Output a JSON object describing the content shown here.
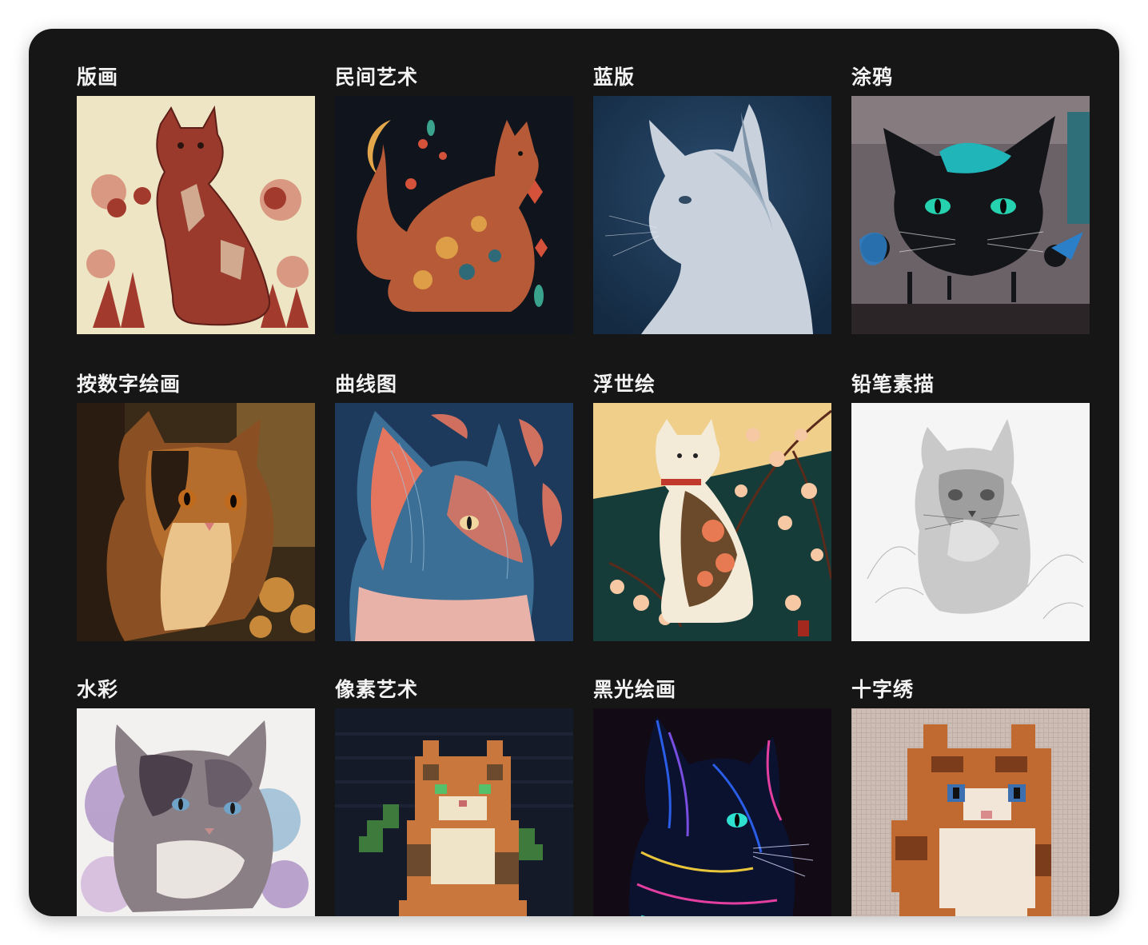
{
  "styles": [
    {
      "id": "print",
      "label": "版画",
      "colors": {
        "bg": "#ede5c4",
        "fg": "#a33a2e",
        "accent": "#7c2a22"
      }
    },
    {
      "id": "folk",
      "label": "民间艺术",
      "colors": {
        "bg": "#10141d",
        "fg": "#b65a37",
        "accent": "#e3a64a"
      }
    },
    {
      "id": "cyanotype",
      "label": "蓝版",
      "colors": {
        "bg": "#1c3957",
        "fg": "#cfd6df",
        "accent": "#2a4b6d"
      }
    },
    {
      "id": "graffiti",
      "label": "涂鸦",
      "colors": {
        "bg": "#6a6267",
        "fg": "#141518",
        "accent": "#1fb5b9"
      }
    },
    {
      "id": "paint-by-number",
      "label": "按数字绘画",
      "colors": {
        "bg": "#3a2a18",
        "fg": "#b46d2c",
        "accent": "#e9c38a"
      }
    },
    {
      "id": "lineart",
      "label": "曲线图",
      "colors": {
        "bg": "#1d3a5c",
        "fg": "#e47660",
        "accent": "#6aa6c9"
      }
    },
    {
      "id": "ukiyoe",
      "label": "浮世绘",
      "colors": {
        "bg": "#163c3a",
        "fg": "#efd0a0",
        "accent": "#e77a52"
      }
    },
    {
      "id": "pencil",
      "label": "铅笔素描",
      "colors": {
        "bg": "#f1f1f1",
        "fg": "#8a8a8a",
        "accent": "#4a4a4a"
      }
    },
    {
      "id": "watercolor",
      "label": "水彩",
      "colors": {
        "bg": "#f3f1ef",
        "fg": "#5b4d6a",
        "accent": "#8b63b0"
      }
    },
    {
      "id": "pixel",
      "label": "像素艺术",
      "colors": {
        "bg": "#151a28",
        "fg": "#c9773c",
        "accent": "#3d7a3b"
      }
    },
    {
      "id": "blacklight",
      "label": "黑光绘画",
      "colors": {
        "bg": "#120a14",
        "fg": "#2a5ee8",
        "accent": "#e23fa0"
      }
    },
    {
      "id": "cross-stitch",
      "label": "十字绣",
      "colors": {
        "bg": "#cdbdb5",
        "fg": "#c06a32",
        "accent": "#f2e6d8"
      }
    }
  ]
}
